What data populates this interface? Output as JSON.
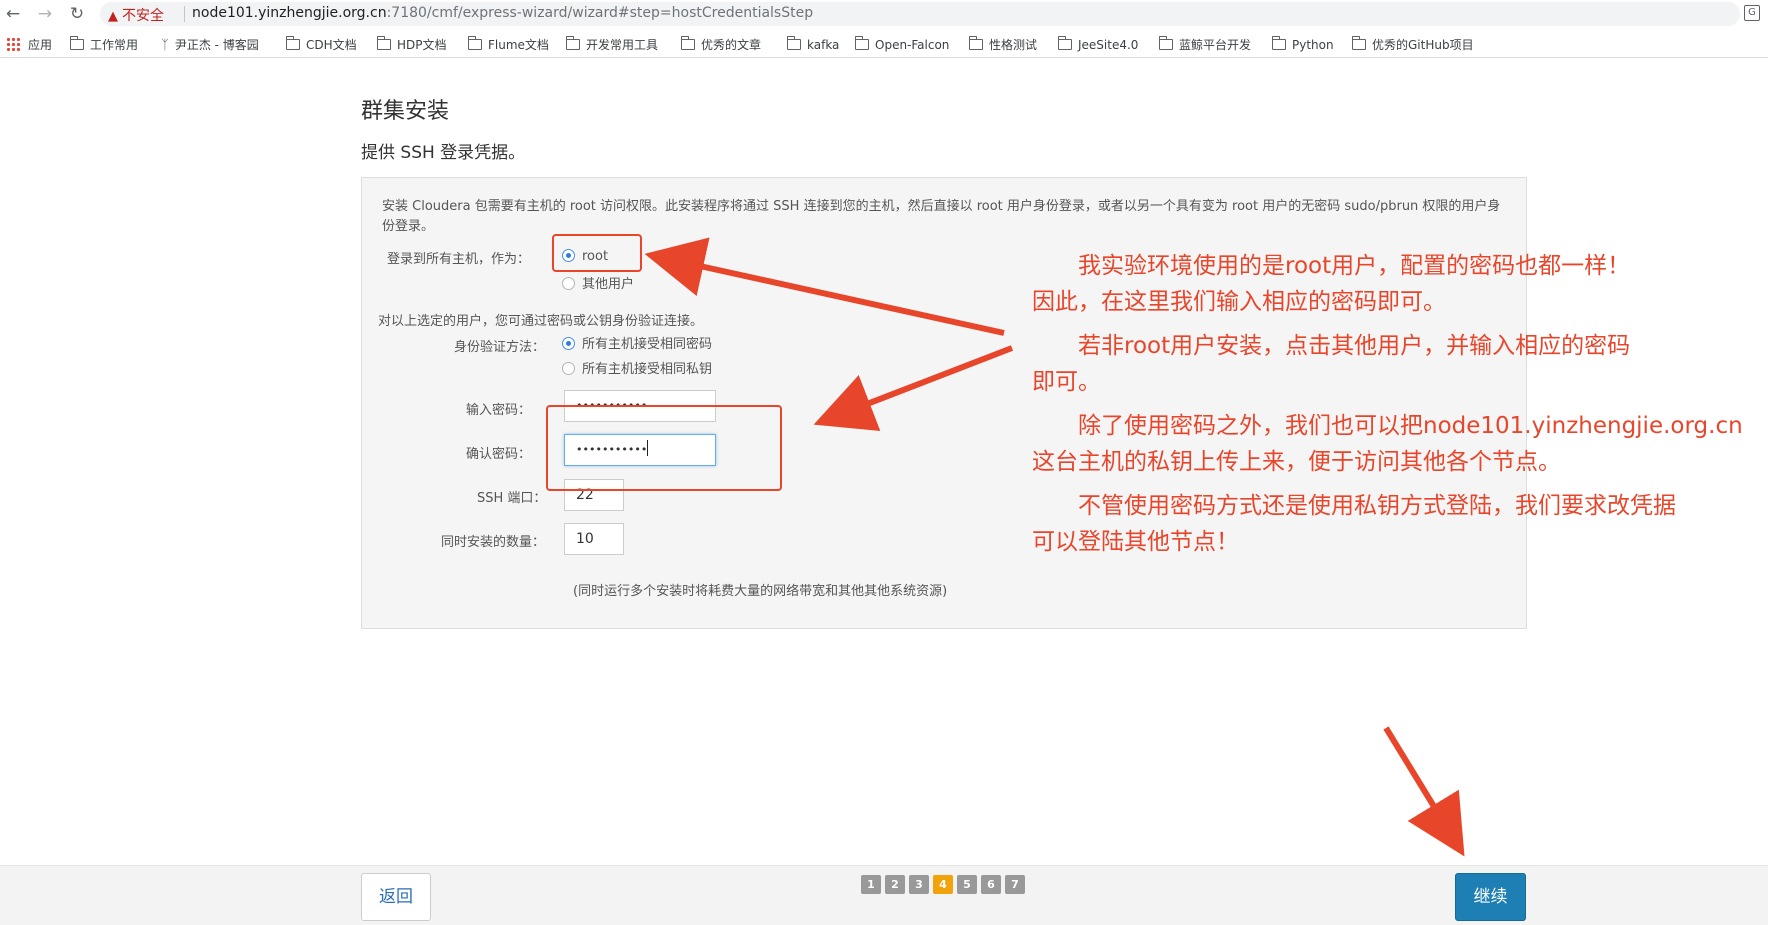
{
  "browser": {
    "security_label": "不安全",
    "url_host": "node101.yinzhengjie.org.cn",
    "url_rest": ":7180/cmf/express-wizard/wizard#step=hostCredentialsStep",
    "bookmarks": [
      {
        "label": "应用",
        "icon": "apps-grid-icon"
      },
      {
        "label": "工作常用",
        "icon": "folder-icon"
      },
      {
        "label": "尹正杰 - 博客园",
        "icon": "blog-icon"
      },
      {
        "label": "CDH文档",
        "icon": "folder-icon"
      },
      {
        "label": "HDP文档",
        "icon": "folder-icon"
      },
      {
        "label": "Flume文档",
        "icon": "folder-icon"
      },
      {
        "label": "开发常用工具",
        "icon": "folder-icon"
      },
      {
        "label": "优秀的文章",
        "icon": "folder-icon"
      },
      {
        "label": "kafka",
        "icon": "folder-icon"
      },
      {
        "label": "Open-Falcon",
        "icon": "folder-icon"
      },
      {
        "label": "性格测试",
        "icon": "folder-icon"
      },
      {
        "label": "JeeSite4.0",
        "icon": "folder-icon"
      },
      {
        "label": "蓝鲸平台开发",
        "icon": "folder-icon"
      },
      {
        "label": "Python",
        "icon": "folder-icon"
      },
      {
        "label": "优秀的GitHub项目",
        "icon": "folder-icon"
      }
    ]
  },
  "page": {
    "title": "群集安装",
    "subtitle": "提供 SSH 登录凭据。"
  },
  "form": {
    "description": "安装 Cloudera 包需要有主机的 root 访问权限。此安装程序将通过 SSH 连接到您的主机，然后直接以 root 用户身份登录，或者以另一个具有变为 root 用户的无密码 sudo/pbrun 权限的用户身份登录。",
    "login_label": "登录到所有主机，作为：",
    "login_options": [
      "root",
      "其他用户"
    ],
    "login_selected": "root",
    "auth_intro": "对以上选定的用户，您可通过密码或公钥身份验证连接。",
    "auth_label": "身份验证方法：",
    "auth_options": [
      "所有主机接受相同密码",
      "所有主机接受相同私钥"
    ],
    "auth_selected": "所有主机接受相同密码",
    "password_label": "输入密码：",
    "password_value": "•••••••••••",
    "confirm_label": "确认密码：",
    "confirm_value": "•••••••••••",
    "ssh_port_label": "SSH 端口：",
    "ssh_port_value": "22",
    "concurrent_label": "同时安装的数量：",
    "concurrent_value": "10",
    "concurrent_note": "(同时运行多个安装时将耗费大量的网络带宽和其他其他系统资源)"
  },
  "annotation": {
    "color": "#e8462b",
    "line1a": "　　我实验环境使用的是root用户，配置的密码也都一样！",
    "line1b": "因此，在这里我们输入相应的密码即可。",
    "line2a": "　　若非root用户安装，点击其他用户，并输入相应的密码",
    "line2b": "即可。",
    "line3a": "　　除了使用密码之外，我们也可以把node101.yinzhengjie.org.cn",
    "line3b": "这台主机的私钥上传上来，便于访问其他各个节点。",
    "line4a": "　　不管使用密码方式还是使用私钥方式登陆，我们要求改凭据",
    "line4b": "可以登陆其他节点！"
  },
  "footer": {
    "back_label": "返回",
    "next_label": "继续",
    "steps": [
      "1",
      "2",
      "3",
      "4",
      "5",
      "6",
      "7"
    ],
    "active_step": "4"
  }
}
